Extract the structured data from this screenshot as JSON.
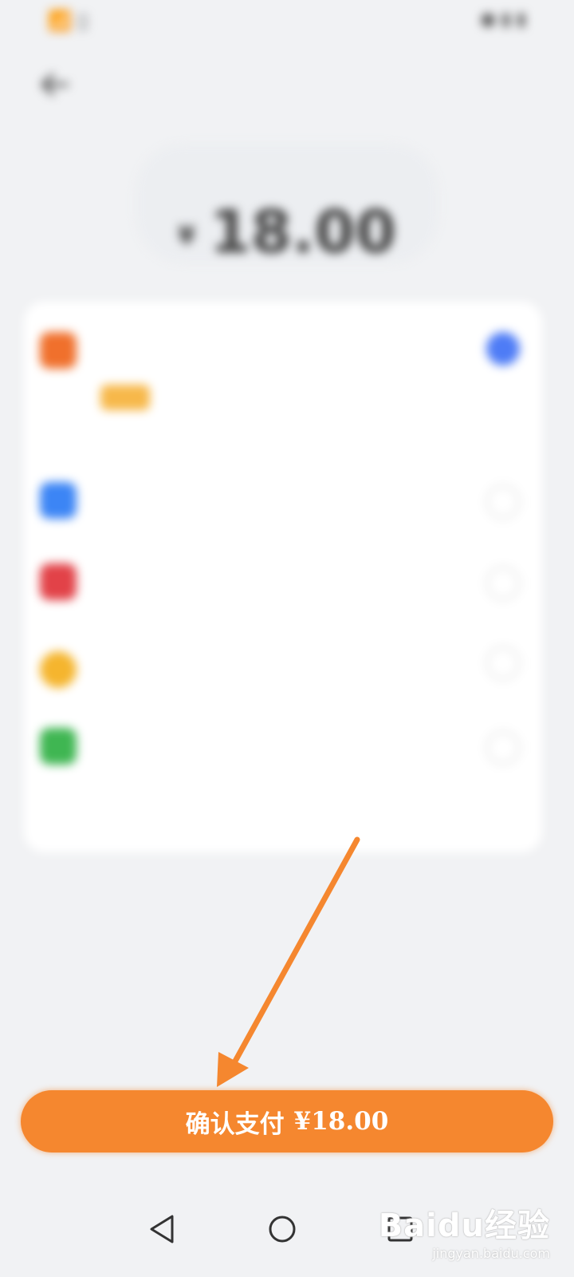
{
  "status_bar": {
    "left": "📶 ▯",
    "right": "● ▮ ▮"
  },
  "header": {
    "title": ""
  },
  "amount": {
    "label": "",
    "currency": "¥",
    "value": "18.00"
  },
  "payment_methods": [
    {
      "name": "",
      "desc": "",
      "sub": "",
      "color": "#f0702c",
      "selected": true
    },
    {
      "name": "",
      "sub": "",
      "color": "#3c85f5",
      "selected": false
    },
    {
      "name": "",
      "sub": "",
      "color": "#e24248",
      "selected": false
    },
    {
      "name": "",
      "sub": "",
      "color": "#f5b52e",
      "selected": false
    },
    {
      "name": "",
      "sub": "",
      "color": "#3fb652",
      "selected": false
    }
  ],
  "more_methods": "",
  "confirm_button": {
    "label": "确认支付",
    "amount": "¥18.00"
  },
  "nav": {
    "back": "back-triangle",
    "home": "home-circle",
    "recents": "recents-square"
  },
  "watermark": {
    "logo": "Baidu经验",
    "url": "jingyan.baidu.com"
  },
  "colors": {
    "accent": "#f5872f",
    "selected": "#4e7cf6",
    "promo": "#f5a24a"
  }
}
